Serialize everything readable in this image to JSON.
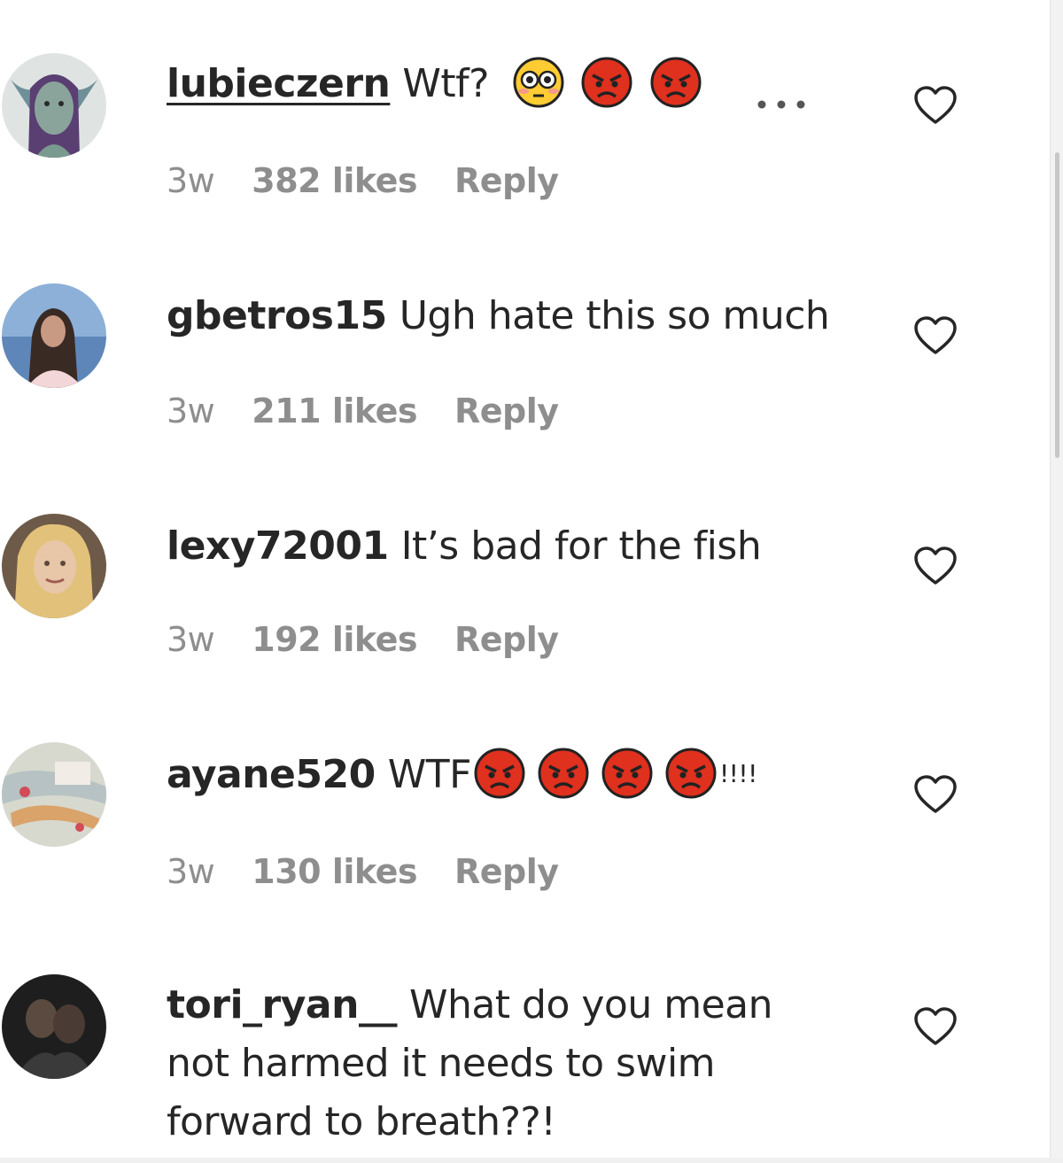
{
  "comments": [
    {
      "username": "lubieczern",
      "text": "Wtf?",
      "time": "3w",
      "likes": "382 likes",
      "reply": "Reply",
      "emojis": [
        "flushed-face",
        "angry-face",
        "angry-face"
      ],
      "underlined": true
    },
    {
      "username": "gbetros15",
      "text": "Ugh hate this so much",
      "time": "3w",
      "likes": "211 likes",
      "reply": "Reply"
    },
    {
      "username": "lexy72001",
      "text": "It’s bad for the fish",
      "time": "3w",
      "likes": "192 likes",
      "reply": "Reply"
    },
    {
      "username": "ayane520",
      "text": "WTF",
      "suffix": "!!!!",
      "time": "3w",
      "likes": "130 likes",
      "reply": "Reply",
      "emojis": [
        "angry-face",
        "angry-face",
        "angry-face",
        "angry-face"
      ]
    },
    {
      "username": "tori_ryan__",
      "text_lines": [
        "What do you mean",
        "not harmed it needs to swim",
        "forward to breath??!"
      ]
    }
  ],
  "more_options_icon": "ellipsis-icon",
  "like_icon": "heart-outline-icon",
  "colors": {
    "username": "#262626",
    "meta": "#8e8e8e",
    "angry_emoji": "#e0301e",
    "flushed_emoji": "#ffcc33"
  }
}
